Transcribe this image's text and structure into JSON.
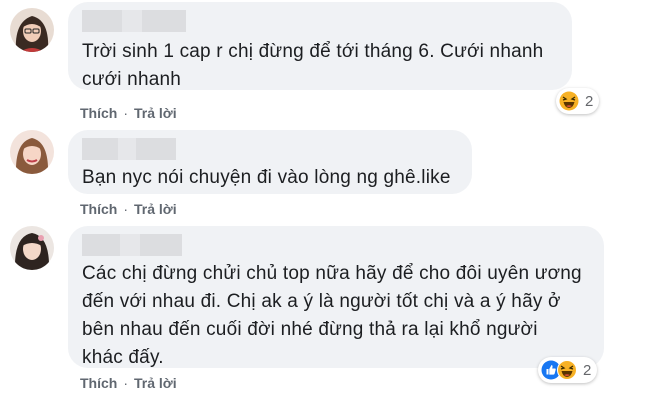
{
  "comments": [
    {
      "text_lines": [
        "Trời sinh 1 cap r chị đừng để tới tháng 6. Cưới nhanh",
        "cưới nhanh"
      ],
      "actions": {
        "like": "Thích",
        "reply": "Trả lời",
        "separator": "·"
      },
      "reactions": {
        "icons": [
          "haha-icon"
        ],
        "count": "2"
      }
    },
    {
      "text_lines": [
        "Bạn nyc nói chuyện đi vào lòng ng ghê.like"
      ],
      "actions": {
        "like": "Thích",
        "reply": "Trả lời",
        "separator": "·"
      }
    },
    {
      "text_lines": [
        "Các chị đừng chửi chủ top nữa hãy để cho đôi uyên ương",
        "đến với nhau đi. Chị ak a ý là người tốt chị và a ý hãy ở",
        "bên nhau đến cuối đời nhé đừng thả ra lại khổ người",
        "khác đấy."
      ],
      "actions": {
        "like": "Thích",
        "reply": "Trả lời",
        "separator": "·"
      },
      "reactions": {
        "icons": [
          "like-icon",
          "haha-icon"
        ],
        "count": "2"
      }
    }
  ],
  "colors": {
    "bubble": "#f0f2f5",
    "action_text": "#606770",
    "like_blue": "#1877f2",
    "haha_yellow": "#f7b125"
  }
}
